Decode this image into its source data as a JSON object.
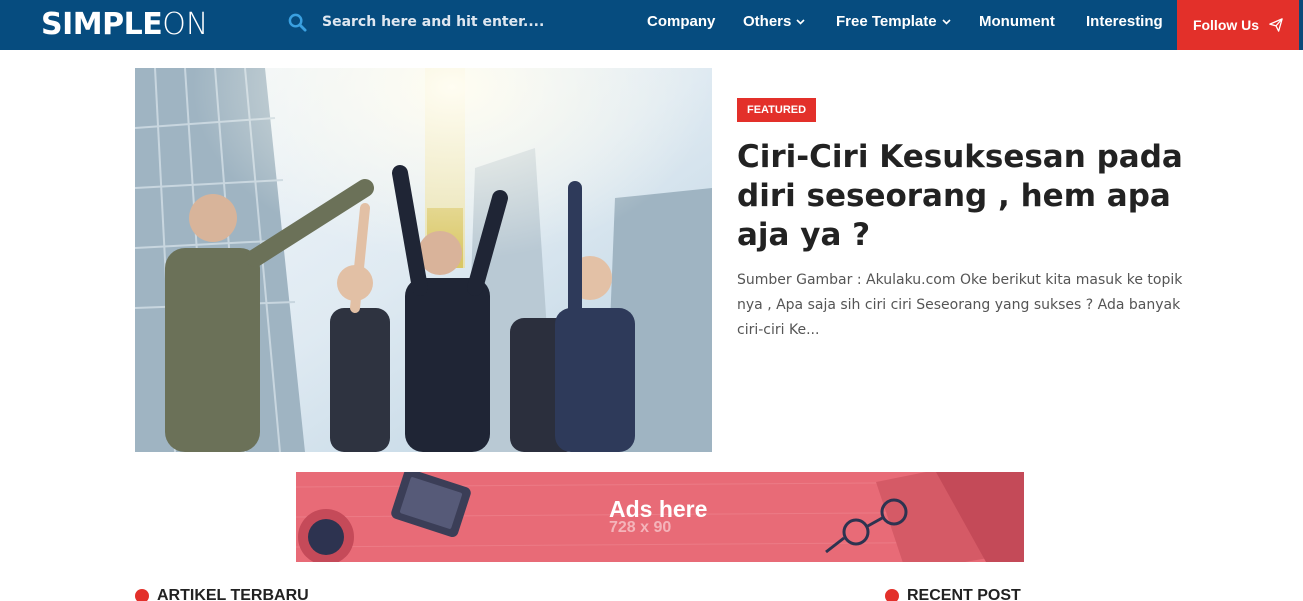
{
  "header": {
    "logo_bold": "SIMPLE",
    "logo_thin": "ON",
    "search_placeholder": "Search here and hit enter....",
    "nav": [
      {
        "label": "Company",
        "has_dropdown": false
      },
      {
        "label": "Others",
        "has_dropdown": true
      },
      {
        "label": "Free Template",
        "has_dropdown": true
      },
      {
        "label": "Monument",
        "has_dropdown": false
      },
      {
        "label": "Interesting",
        "has_dropdown": false
      }
    ],
    "follow_label": "Follow Us",
    "colors": {
      "bar": "#064c7f",
      "accent": "#e3302a"
    }
  },
  "featured": {
    "badge": "FEATURED",
    "title": "Ciri-Ciri Kesuksesan pada diri seseorang , hem apa aja ya ?",
    "excerpt": "Sumber Gambar :  Akulaku.com   Oke berikut kita masuk ke topik nya , Apa saja sih ciri ciri  Seseorang yang sukses ? Ada banyak ciri-ciri Ke...",
    "image": "business people celebrating with raised arms"
  },
  "ad": {
    "title": "Ads here",
    "size": "728 x 90"
  },
  "sections": {
    "left_heading": "ARTIKEL TERBARU",
    "right_heading": "RECENT POST"
  }
}
